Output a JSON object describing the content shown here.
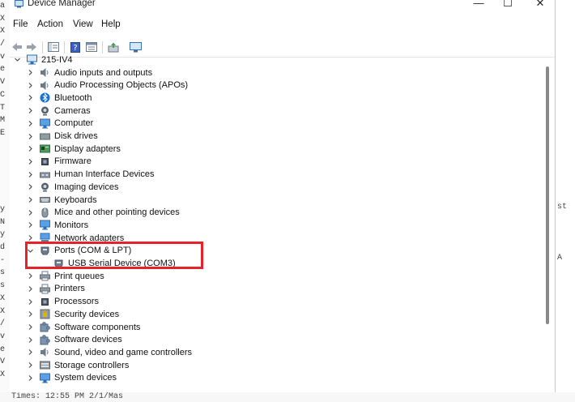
{
  "window": {
    "title": "Device Manager",
    "minimize_glyph": "—",
    "maximize_glyph": "☐",
    "close_glyph": "✕"
  },
  "menu": [
    "File",
    "Action",
    "View",
    "Help"
  ],
  "tree": {
    "root": "215-IV4",
    "categories": [
      {
        "label": "Audio inputs and outputs",
        "icon": "speaker-icon"
      },
      {
        "label": "Audio Processing Objects (APOs)",
        "icon": "speaker-icon"
      },
      {
        "label": "Bluetooth",
        "icon": "bluetooth-icon"
      },
      {
        "label": "Cameras",
        "icon": "camera-icon"
      },
      {
        "label": "Computer",
        "icon": "monitor-icon"
      },
      {
        "label": "Disk drives",
        "icon": "disk-drive-icon"
      },
      {
        "label": "Display adapters",
        "icon": "display-adapter-icon"
      },
      {
        "label": "Firmware",
        "icon": "chip-icon"
      },
      {
        "label": "Human Interface Devices",
        "icon": "hid-icon"
      },
      {
        "label": "Imaging devices",
        "icon": "camera-icon"
      },
      {
        "label": "Keyboards",
        "icon": "keyboard-icon"
      },
      {
        "label": "Mice and other pointing devices",
        "icon": "mouse-icon"
      },
      {
        "label": "Monitors",
        "icon": "monitor-icon"
      },
      {
        "label": "Network adapters",
        "icon": "network-icon"
      },
      {
        "label": "Ports (COM & LPT)",
        "icon": "port-icon",
        "expanded": true,
        "children": [
          {
            "label": "USB Serial Device (COM3)",
            "icon": "port-icon"
          }
        ]
      },
      {
        "label": "Print queues",
        "icon": "printer-icon"
      },
      {
        "label": "Printers",
        "icon": "printer-icon"
      },
      {
        "label": "Processors",
        "icon": "chip-icon"
      },
      {
        "label": "Security devices",
        "icon": "security-icon"
      },
      {
        "label": "Software components",
        "icon": "puzzle-icon"
      },
      {
        "label": "Software devices",
        "icon": "puzzle-icon"
      },
      {
        "label": "Sound, video and game controllers",
        "icon": "speaker-icon"
      },
      {
        "label": "Storage controllers",
        "icon": "storage-icon"
      },
      {
        "label": "System devices",
        "icon": "monitor-icon"
      }
    ]
  },
  "background_terminal": {
    "left_chars": [
      "a",
      "X",
      "X",
      "/",
      "v",
      "e",
      "V",
      "C",
      "T",
      "M",
      "E",
      "",
      "",
      "",
      "",
      "",
      "y",
      "N",
      "y",
      "d",
      "-",
      "s",
      "s",
      "X",
      "X",
      "/",
      "v",
      "e",
      "V",
      "X"
    ],
    "right_chars": [
      "st",
      "A"
    ],
    "bottom_text": "Times: 12:55 PM 2/1/Mas"
  },
  "colors": {
    "highlight": "#e8202a",
    "folder_blue": "#3a7bd5"
  }
}
